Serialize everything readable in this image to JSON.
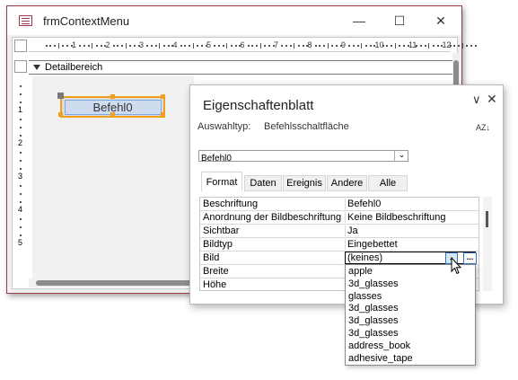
{
  "form_window": {
    "title": "frmContextMenu",
    "minimize_glyph": "—",
    "maximize_glyph": "☐",
    "close_glyph": "✕",
    "section_label": "Detailbereich",
    "ruler_numbers": [
      "1",
      "2",
      "3",
      "4",
      "5",
      "6",
      "7",
      "8",
      "9",
      "10",
      "11",
      "12"
    ],
    "ruler_left_numbers": [
      "1",
      "2",
      "3",
      "4",
      "5"
    ],
    "button_label": "Befehl0"
  },
  "property_sheet": {
    "title": "Eigenschaftenblatt",
    "chevron_glyph": "∨",
    "close_glyph": "✕",
    "selection_type_label": "Auswahltyp:",
    "selection_type_value": "Befehlsschaltfläche",
    "sort_icon_text": "AZ↓",
    "object_combo_value": "Befehl0",
    "combo_arrow_glyph": "⌄",
    "tabs": [
      {
        "label": "Format",
        "active": true
      },
      {
        "label": "Daten",
        "active": false
      },
      {
        "label": "Ereignis",
        "active": false
      },
      {
        "label": "Andere",
        "active": false
      },
      {
        "label": "Alle",
        "active": false
      }
    ],
    "properties": [
      {
        "name": "Beschriftung",
        "value": "Befehl0"
      },
      {
        "name": "Anordnung der Bildbeschriftung",
        "value": "Keine Bildbeschriftung"
      },
      {
        "name": "Sichtbar",
        "value": "Ja"
      },
      {
        "name": "Bildtyp",
        "value": "Eingebettet"
      },
      {
        "name": "Bild",
        "value": "(keines)"
      },
      {
        "name": "Breite",
        "value": ""
      },
      {
        "name": "Höhe",
        "value": ""
      }
    ],
    "dropdown_arrow_glyph": "⌄",
    "builder_glyph": "..."
  },
  "dropdown_list": {
    "items": [
      "apple",
      "3d_glasses",
      "glasses",
      "3d_glasses",
      "3d_glasses",
      "3d_glasses",
      "address_book",
      "adhesive_tape"
    ]
  },
  "colors": {
    "window_border": "#9d3b4a",
    "selection_handle": "#f0a020",
    "focus_blue": "#2f77c8"
  }
}
